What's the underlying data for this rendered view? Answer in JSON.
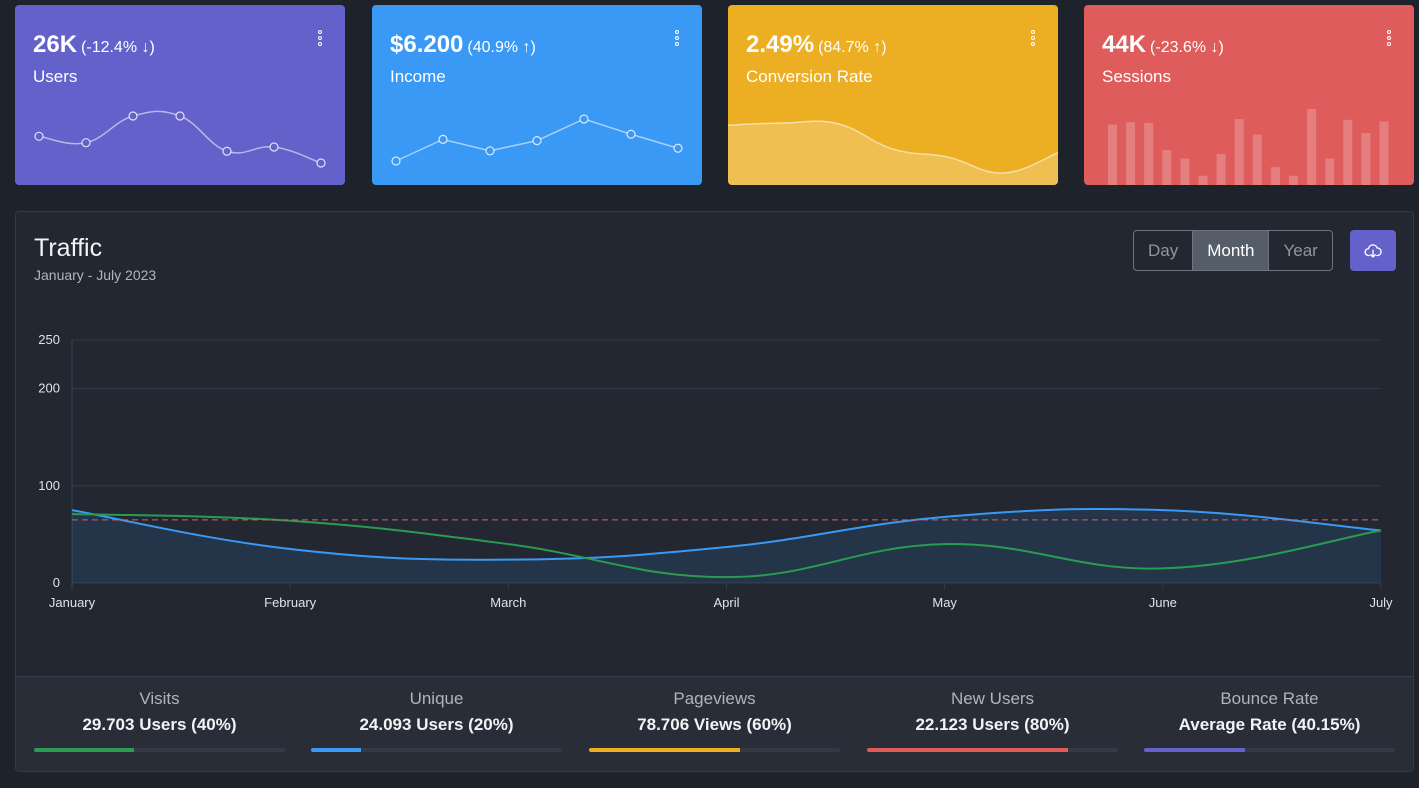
{
  "cards": [
    {
      "value": "26K",
      "delta": "(-12.4% ↓)",
      "label": "Users",
      "color": "#6461cb",
      "menu_icon": "vertical-dots-icon"
    },
    {
      "value": "$6.200",
      "delta": "(40.9% ↑)",
      "label": "Income",
      "color": "#3a99f5",
      "menu_icon": "vertical-dots-icon"
    },
    {
      "value": "2.49%",
      "delta": "(84.7% ↑)",
      "label": "Conversion Rate",
      "color": "#ecae22",
      "menu_icon": "vertical-dots-icon"
    },
    {
      "value": "44K",
      "delta": "(-23.6% ↓)",
      "label": "Sessions",
      "color": "#de5c5c",
      "menu_icon": "vertical-dots-icon"
    }
  ],
  "traffic": {
    "title": "Traffic",
    "subtitle": "January - July 2023",
    "range_buttons": [
      {
        "label": "Day",
        "active": false
      },
      {
        "label": "Month",
        "active": true
      },
      {
        "label": "Year",
        "active": false
      }
    ],
    "download_icon": "cloud-download-icon"
  },
  "chart_data": [
    {
      "type": "line",
      "series": [
        {
          "values": [
            65,
            59,
            84,
            84,
            51,
            55,
            40
          ]
        }
      ]
    },
    {
      "type": "line",
      "series": [
        {
          "values": [
            1,
            18,
            9,
            17,
            34,
            22,
            11
          ]
        }
      ]
    },
    {
      "type": "area",
      "series": [
        {
          "values": [
            78,
            81,
            80,
            45,
            34,
            12,
            40
          ]
        }
      ]
    },
    {
      "type": "bar",
      "series": [
        {
          "values": [
            78,
            81,
            80,
            45,
            34,
            12,
            40,
            85,
            65,
            23,
            12,
            98,
            34,
            84,
            67,
            82
          ]
        }
      ]
    },
    {
      "type": "line",
      "categories": [
        "January",
        "February",
        "March",
        "April",
        "May",
        "June",
        "July"
      ],
      "ylim": [
        0,
        250
      ],
      "yticks": [
        0,
        100,
        200,
        250
      ],
      "grid": true,
      "series": [
        {
          "values": [
            75,
            35,
            24,
            37,
            68,
            75,
            54
          ],
          "color": "#3a99f5",
          "fill": true
        },
        {
          "values": [
            71,
            64,
            40,
            6,
            40,
            15,
            54
          ],
          "color": "#2b9b52"
        },
        {
          "values": [
            65,
            65,
            65,
            65,
            65,
            65,
            65
          ],
          "color": "#de5c5c",
          "dashed": true
        }
      ]
    }
  ],
  "stats": [
    {
      "label": "Visits",
      "value": "29.703 Users (40%)",
      "progress": 40,
      "color": "#2b9b52"
    },
    {
      "label": "Unique",
      "value": "24.093 Users (20%)",
      "progress": 20,
      "color": "#3a99f5"
    },
    {
      "label": "Pageviews",
      "value": "78.706 Views (60%)",
      "progress": 60,
      "color": "#ecae22"
    },
    {
      "label": "New Users",
      "value": "22.123 Users (80%)",
      "progress": 80,
      "color": "#de5c5c"
    },
    {
      "label": "Bounce Rate",
      "value": "Average Rate (40.15%)",
      "progress": 40.15,
      "color": "#6461cb"
    }
  ]
}
